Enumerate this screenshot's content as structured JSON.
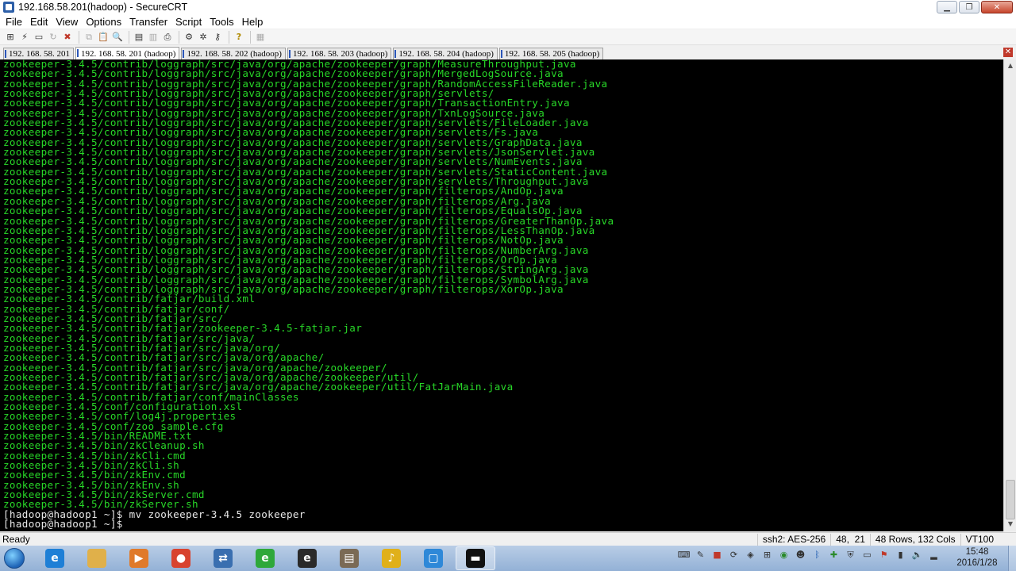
{
  "window": {
    "title": "192.168.58.201(hadoop) - SecureCRT"
  },
  "menu": [
    "File",
    "Edit",
    "View",
    "Options",
    "Transfer",
    "Script",
    "Tools",
    "Help"
  ],
  "toolbar_icons": [
    "connect-icon",
    "quick-connect-icon",
    "connect-tab-icon",
    "reconnect-icon",
    "disconnect-icon",
    "copy-icon",
    "paste-icon",
    "find-icon",
    "print-icon",
    "print-selection-icon",
    "printer-icon",
    "session-options-icon",
    "global-options-icon",
    "keymap-icon",
    "help-icon",
    "sftp-icon"
  ],
  "tabs": [
    {
      "label": "192. 168. 58. 201",
      "active": false
    },
    {
      "label": "192. 168. 58. 201 (hadoop)",
      "active": true
    },
    {
      "label": "192. 168. 58. 202 (hadoop)",
      "active": false
    },
    {
      "label": "192. 168. 58. 203 (hadoop)",
      "active": false
    },
    {
      "label": "192. 168. 58. 204 (hadoop)",
      "active": false
    },
    {
      "label": "192. 168. 58. 205 (hadoop)",
      "active": false
    }
  ],
  "terminal": {
    "lines": [
      "zookeeper-3.4.5/contrib/loggraph/src/java/org/apache/zookeeper/graph/MeasureThroughput.java",
      "zookeeper-3.4.5/contrib/loggraph/src/java/org/apache/zookeeper/graph/MergedLogSource.java",
      "zookeeper-3.4.5/contrib/loggraph/src/java/org/apache/zookeeper/graph/RandomAccessFileReader.java",
      "zookeeper-3.4.5/contrib/loggraph/src/java/org/apache/zookeeper/graph/servlets/",
      "zookeeper-3.4.5/contrib/loggraph/src/java/org/apache/zookeeper/graph/TransactionEntry.java",
      "zookeeper-3.4.5/contrib/loggraph/src/java/org/apache/zookeeper/graph/TxnLogSource.java",
      "zookeeper-3.4.5/contrib/loggraph/src/java/org/apache/zookeeper/graph/servlets/FileLoader.java",
      "zookeeper-3.4.5/contrib/loggraph/src/java/org/apache/zookeeper/graph/servlets/Fs.java",
      "zookeeper-3.4.5/contrib/loggraph/src/java/org/apache/zookeeper/graph/servlets/GraphData.java",
      "zookeeper-3.4.5/contrib/loggraph/src/java/org/apache/zookeeper/graph/servlets/JsonServlet.java",
      "zookeeper-3.4.5/contrib/loggraph/src/java/org/apache/zookeeper/graph/servlets/NumEvents.java",
      "zookeeper-3.4.5/contrib/loggraph/src/java/org/apache/zookeeper/graph/servlets/StaticContent.java",
      "zookeeper-3.4.5/contrib/loggraph/src/java/org/apache/zookeeper/graph/servlets/Throughput.java",
      "zookeeper-3.4.5/contrib/loggraph/src/java/org/apache/zookeeper/graph/filterops/AndOp.java",
      "zookeeper-3.4.5/contrib/loggraph/src/java/org/apache/zookeeper/graph/filterops/Arg.java",
      "zookeeper-3.4.5/contrib/loggraph/src/java/org/apache/zookeeper/graph/filterops/EqualsOp.java",
      "zookeeper-3.4.5/contrib/loggraph/src/java/org/apache/zookeeper/graph/filterops/GreaterThanOp.java",
      "zookeeper-3.4.5/contrib/loggraph/src/java/org/apache/zookeeper/graph/filterops/LessThanOp.java",
      "zookeeper-3.4.5/contrib/loggraph/src/java/org/apache/zookeeper/graph/filterops/NotOp.java",
      "zookeeper-3.4.5/contrib/loggraph/src/java/org/apache/zookeeper/graph/filterops/NumberArg.java",
      "zookeeper-3.4.5/contrib/loggraph/src/java/org/apache/zookeeper/graph/filterops/OrOp.java",
      "zookeeper-3.4.5/contrib/loggraph/src/java/org/apache/zookeeper/graph/filterops/StringArg.java",
      "zookeeper-3.4.5/contrib/loggraph/src/java/org/apache/zookeeper/graph/filterops/SymbolArg.java",
      "zookeeper-3.4.5/contrib/loggraph/src/java/org/apache/zookeeper/graph/filterops/XorOp.java",
      "zookeeper-3.4.5/contrib/fatjar/build.xml",
      "zookeeper-3.4.5/contrib/fatjar/conf/",
      "zookeeper-3.4.5/contrib/fatjar/src/",
      "zookeeper-3.4.5/contrib/fatjar/zookeeper-3.4.5-fatjar.jar",
      "zookeeper-3.4.5/contrib/fatjar/src/java/",
      "zookeeper-3.4.5/contrib/fatjar/src/java/org/",
      "zookeeper-3.4.5/contrib/fatjar/src/java/org/apache/",
      "zookeeper-3.4.5/contrib/fatjar/src/java/org/apache/zookeeper/",
      "zookeeper-3.4.5/contrib/fatjar/src/java/org/apache/zookeeper/util/",
      "zookeeper-3.4.5/contrib/fatjar/src/java/org/apache/zookeeper/util/FatJarMain.java",
      "zookeeper-3.4.5/contrib/fatjar/conf/mainClasses",
      "zookeeper-3.4.5/conf/configuration.xsl",
      "zookeeper-3.4.5/conf/log4j.properties",
      "zookeeper-3.4.5/conf/zoo_sample.cfg",
      "zookeeper-3.4.5/bin/README.txt",
      "zookeeper-3.4.5/bin/zkCleanup.sh",
      "zookeeper-3.4.5/bin/zkCli.cmd",
      "zookeeper-3.4.5/bin/zkCli.sh",
      "zookeeper-3.4.5/bin/zkEnv.cmd",
      "zookeeper-3.4.5/bin/zkEnv.sh",
      "zookeeper-3.4.5/bin/zkServer.cmd",
      "zookeeper-3.4.5/bin/zkServer.sh"
    ],
    "prompt_lines": [
      "[hadoop@hadoop1 ~]$ mv zookeeper-3.4.5 zookeeper",
      "[hadoop@hadoop1 ~]$ "
    ],
    "text_color": "#28d728",
    "prompt_color": "#e8e8e8",
    "background": "#000000"
  },
  "status": {
    "ready": "Ready",
    "protocol": "ssh2: AES-256",
    "cursor": "48,  21",
    "size": "48 Rows, 132 Cols",
    "emulation": "VT100"
  },
  "taskbar": {
    "apps": [
      {
        "name": "internet-explorer-icon",
        "color": "#1e7fd6",
        "glyph": "e"
      },
      {
        "name": "file-explorer-icon",
        "color": "#e0b04a",
        "glyph": ""
      },
      {
        "name": "media-player-icon",
        "color": "#e07a2a",
        "glyph": "▶"
      },
      {
        "name": "chrome-icon",
        "color": "#d8432f",
        "glyph": "●"
      },
      {
        "name": "network-tool-icon",
        "color": "#3a6fb0",
        "glyph": "⇄"
      },
      {
        "name": "refresh-app-icon",
        "color": "#2fa83a",
        "glyph": "e"
      },
      {
        "name": "ie-alt-icon",
        "color": "#2a2a2a",
        "glyph": "e"
      },
      {
        "name": "archive-icon",
        "color": "#7a6a55",
        "glyph": "▤"
      },
      {
        "name": "music-player-icon",
        "color": "#e0b01a",
        "glyph": "♪"
      },
      {
        "name": "virtual-machine-icon",
        "color": "#2e88d8",
        "glyph": "▢"
      },
      {
        "name": "terminal-icon",
        "color": "#111111",
        "glyph": "▬"
      }
    ],
    "active_app": "terminal-icon",
    "clock_time": "15:48",
    "clock_date": "2016/1/28"
  }
}
